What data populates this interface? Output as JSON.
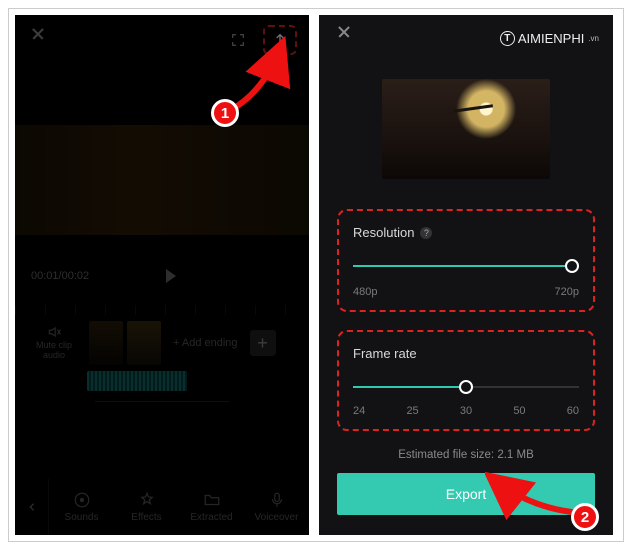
{
  "watermark": {
    "brand": "AIMIENPHI",
    "suffix": ".vn",
    "letter": "T"
  },
  "left": {
    "time": "00:01/00:02",
    "mute_label": "Mute clip audio",
    "add_ending": "+ Add ending",
    "footer": {
      "sounds": "Sounds",
      "effects": "Effects",
      "extracted": "Extracted",
      "voiceover": "Voiceover"
    }
  },
  "right": {
    "resolution": {
      "title": "Resolution",
      "min": "480p",
      "max": "720p"
    },
    "framerate": {
      "title": "Frame rate",
      "ticks": [
        "24",
        "25",
        "30",
        "50",
        "60"
      ]
    },
    "filesize": "Estimated file size: 2.1 MB",
    "export": "Export"
  },
  "badges": {
    "one": "1",
    "two": "2"
  }
}
